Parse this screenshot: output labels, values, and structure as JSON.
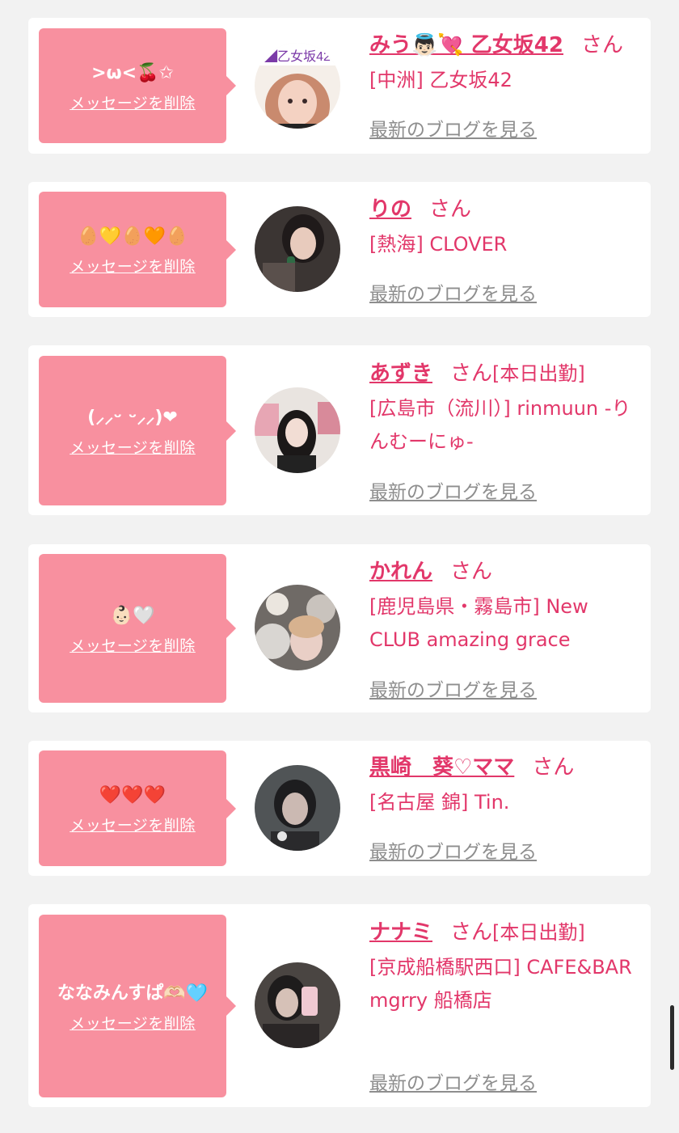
{
  "colors": {
    "accent": "#e2376a",
    "bubble": "#f8909f",
    "link_gray": "#8e8e8e",
    "background": "#f2f2f2"
  },
  "entries": [
    {
      "message": ">ω<🍒✩",
      "delete_label": "メッセージを削除",
      "avatar": "girl-photo-icon",
      "name": "みう👼🏻💘 乙女坂42",
      "honorific": "さん",
      "status": "",
      "shop": "[中洲] 乙女坂42",
      "blog_label": "最新のブログを見る"
    },
    {
      "message": "🥚💛🥚🧡🥚",
      "delete_label": "メッセージを削除",
      "avatar": "girl-photo-icon",
      "name": "りの",
      "honorific": "さん",
      "status": "",
      "shop": "[熱海] CLOVER",
      "blog_label": "最新のブログを見る"
    },
    {
      "message": "(⸝⸝ᵕ ᵕ⸝⸝)❤︎",
      "delete_label": "メッセージを削除",
      "avatar": "girl-photo-icon",
      "name": "あずき",
      "honorific": "さん",
      "status": "[本日出勤]",
      "shop": "[広島市（流川）] rinmuun -りんむーにゅ-",
      "blog_label": "最新のブログを見る"
    },
    {
      "message": "👶🏻🤍",
      "delete_label": "メッセージを削除",
      "avatar": "girl-photo-icon",
      "name": "かれん",
      "honorific": "さん",
      "status": "",
      "shop": "[鹿児島県・霧島市] New CLUB amazing grace",
      "blog_label": "最新のブログを見る"
    },
    {
      "message": "❤️❤️❤️",
      "delete_label": "メッセージを削除",
      "avatar": "girl-photo-icon",
      "name": "黒崎　葵♡ママ",
      "honorific": "さん",
      "status": "",
      "shop": "[名古屋 錦] Tin.",
      "blog_label": "最新のブログを見る"
    },
    {
      "message": "ななみんすぱ🫶🏻🩵",
      "delete_label": "メッセージを削除",
      "avatar": "girl-photo-icon",
      "name": "ナナミ",
      "honorific": "さん",
      "status": "[本日出勤]",
      "shop": "[京成船橋駅西口] CAFE&BAR mgrry 船橋店",
      "blog_label": "最新のブログを見る"
    }
  ]
}
